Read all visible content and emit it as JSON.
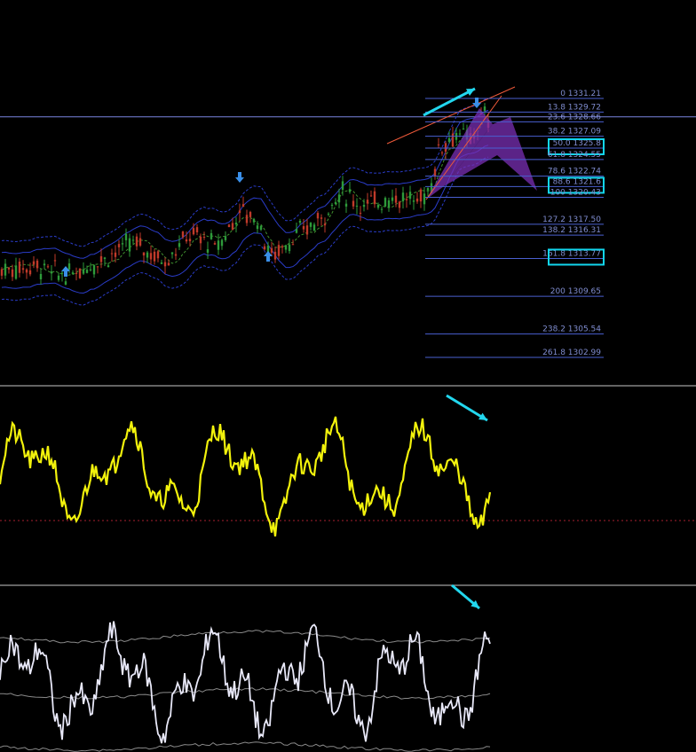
{
  "colors": {
    "background": "#000000",
    "fib_line": "#4a5fd0",
    "fib_text": "#8a96d8",
    "highlight_box": "#12d6ee",
    "divergence_arrow": "#22d7ee",
    "fractal_arrow": "#3a8fe8",
    "bull_candle": "#2e9b3a",
    "bear_candle": "#c03a2a",
    "price_line": "#7b86e0",
    "harmonic_fill": "#7a2fb4",
    "trend_line": "#f05a3a",
    "oscillator_1": "#f2f20c",
    "oscillator_2": "#e8e8f8",
    "oscillator_band": "#8a8a8a",
    "zero_line": "#a82030",
    "separator": "#c8c8c8"
  },
  "icons": [
    "fractal-up-arrow-icon",
    "fractal-down-arrow-icon",
    "divergence-arrow-icon"
  ],
  "chart_data": [
    {
      "type": "line",
      "panel": "price",
      "fib_levels": [
        {
          "level": "0",
          "price": "1331.21",
          "highlighted": false
        },
        {
          "level": "13.8",
          "price": "1329.72",
          "highlighted": false
        },
        {
          "level": "23.6",
          "price": "1328.66",
          "highlighted": false
        },
        {
          "level": "38.2",
          "price": "1327.09",
          "highlighted": false
        },
        {
          "level": "50.0",
          "price": "1325.8",
          "highlighted": true
        },
        {
          "level": "61.8",
          "price": "1324.55",
          "highlighted": false
        },
        {
          "level": "78.6",
          "price": "1322.74",
          "highlighted": false
        },
        {
          "level": "88.6",
          "price": "1321.6",
          "highlighted": true
        },
        {
          "level": "100",
          "price": "1320.43",
          "highlighted": false
        },
        {
          "level": "127.2",
          "price": "1317.50",
          "highlighted": false
        },
        {
          "level": "138.2",
          "price": "1316.31",
          "highlighted": false
        },
        {
          "level": "161.8",
          "price": "1313.77",
          "highlighted": true
        },
        {
          "level": "200",
          "price": "1309.65",
          "highlighted": false
        },
        {
          "level": "238.2",
          "price": "1305.54",
          "highlighted": false
        },
        {
          "level": "261.8",
          "price": "1302.99",
          "highlighted": false
        }
      ],
      "current_price": 1329.2,
      "grid": false
    },
    {
      "type": "line",
      "panel": "oscillator-1",
      "grid": false
    },
    {
      "type": "line",
      "panel": "oscillator-2",
      "grid": false
    }
  ]
}
